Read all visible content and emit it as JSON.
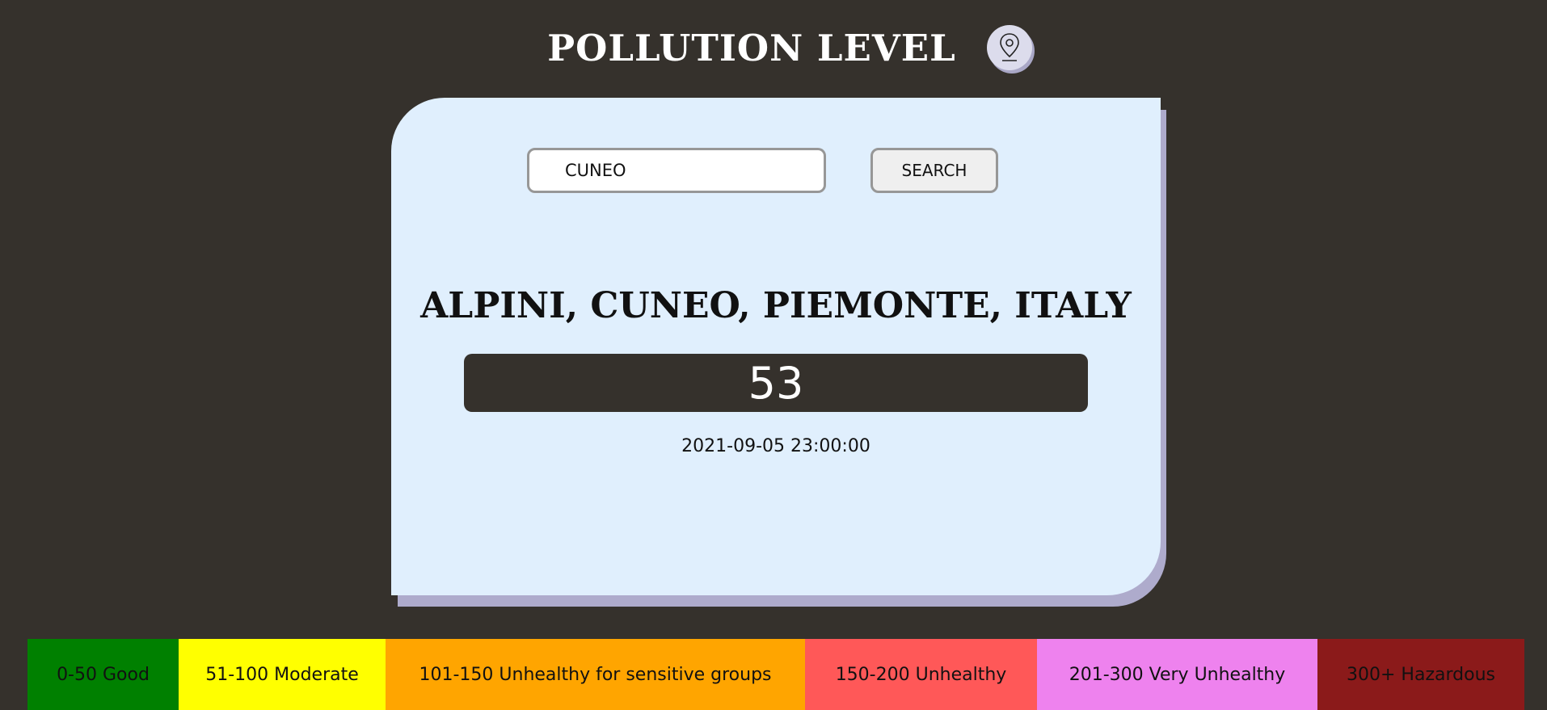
{
  "header": {
    "title": "POLLUTION LEVEL",
    "location_icon": "map-pin-icon"
  },
  "search": {
    "value": "CUNEO",
    "button_label": "SEARCH"
  },
  "result": {
    "location": "ALPINI, CUNEO, PIEMONTE, ITALY",
    "aqi": "53",
    "timestamp": "2021-09-05 23:00:00"
  },
  "legend": [
    {
      "label": "0-50 Good",
      "color": "#008000"
    },
    {
      "label": "51-100 Moderate",
      "color": "#ffff00"
    },
    {
      "label": "101-150 Unhealthy for sensitive groups",
      "color": "#ffa500"
    },
    {
      "label": "150-200 Unhealthy",
      "color": "#ff5858"
    },
    {
      "label": "201-300 Very Unhealthy",
      "color": "#ee82ee"
    },
    {
      "label": "300+ Hazardous",
      "color": "#8b1a1a"
    }
  ],
  "colors": {
    "background": "#35312c",
    "card": "#e0effd",
    "card_shadow": "#aeabcc"
  }
}
